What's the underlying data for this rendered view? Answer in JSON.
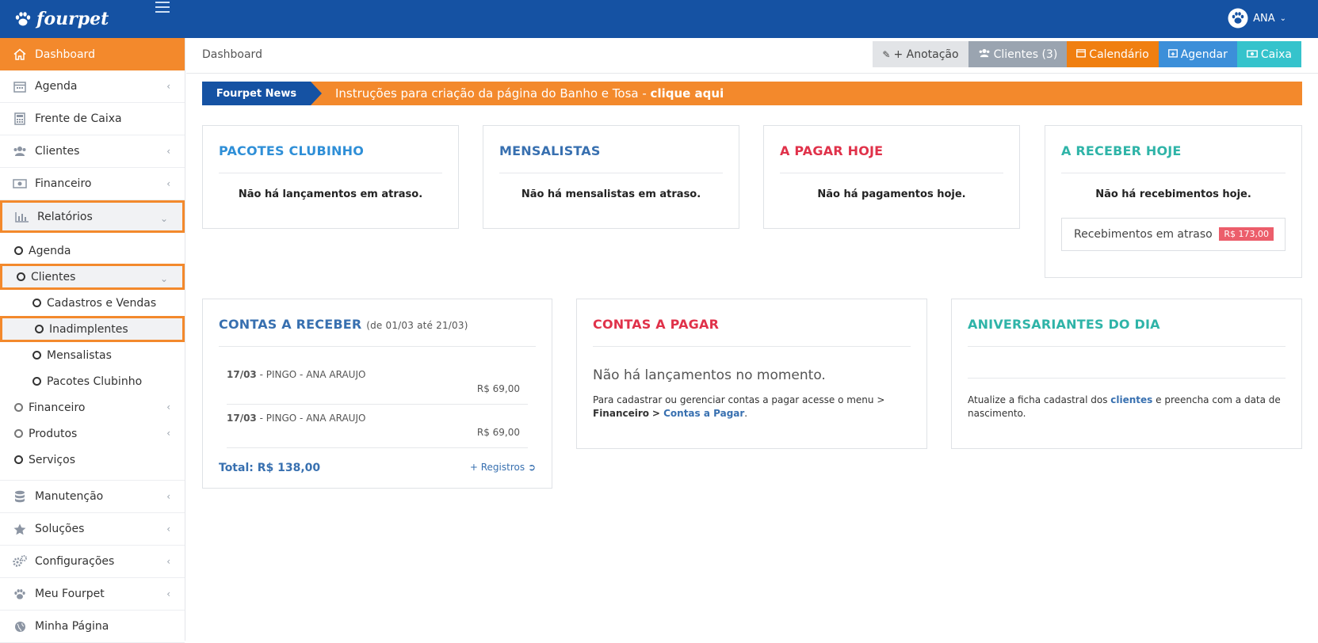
{
  "brand": {
    "name": "fourpet"
  },
  "user": {
    "name": "ANA"
  },
  "sidebar": {
    "dashboard": "Dashboard",
    "agenda": "Agenda",
    "frente_caixa": "Frente de Caixa",
    "clientes": "Clientes",
    "financeiro": "Financeiro",
    "relatorios": "Relatórios",
    "relatorios_sub": {
      "agenda": "Agenda",
      "clientes": "Clientes",
      "cadastros": "Cadastros e Vendas",
      "inadimplentes": "Inadimplentes",
      "mensalistas": "Mensalistas",
      "pacotes": "Pacotes Clubinho",
      "financeiro": "Financeiro",
      "produtos": "Produtos",
      "servicos": "Serviços"
    },
    "manutencao": "Manutenção",
    "solucoes": "Soluções",
    "configuracoes": "Configurações",
    "meu_fourpet": "Meu Fourpet",
    "minha_pagina": "Minha Página"
  },
  "header": {
    "breadcrumb": "Dashboard",
    "buttons": {
      "anotacao": "+ Anotação",
      "clientes": "Clientes (3)",
      "calendario": "Calendário",
      "agendar": "Agendar",
      "caixa": "Caixa"
    }
  },
  "news": {
    "label": "Fourpet News",
    "text": "Instruções para criação da página do Banho e Tosa - ",
    "link": "clique aqui"
  },
  "cards": {
    "pacotes": {
      "title": "PACOTES CLUBINHO",
      "msg": "Não há lançamentos em atraso."
    },
    "mensalistas": {
      "title": "MENSALISTAS",
      "msg": "Não há mensalistas em atraso."
    },
    "pagar_hoje": {
      "title": "A PAGAR HOJE",
      "msg": "Não há pagamentos hoje."
    },
    "receber_hoje": {
      "title": "A RECEBER HOJE",
      "msg": "Não há recebimentos hoje.",
      "overdue_label": "Recebimentos em atraso",
      "overdue_value": "R$ 173,00"
    },
    "contas_receber": {
      "title": "CONTAS A RECEBER",
      "range": "(de 01/03 até 21/03)",
      "rows": [
        {
          "date": "17/03",
          "desc": " - PINGO - ANA ARAUJO",
          "value": "R$ 69,00"
        },
        {
          "date": "17/03",
          "desc": " - PINGO - ANA ARAUJO",
          "value": "R$ 69,00"
        }
      ],
      "total": "Total: R$ 138,00",
      "more": "+ Registros"
    },
    "contas_pagar": {
      "title": "CONTAS A PAGAR",
      "empty": "Não há lançamentos no momento.",
      "help_1": "Para cadastrar ou gerenciar contas a pagar acesse o menu > ",
      "help_link_1": "Financeiro",
      "help_2": "> ",
      "help_link_2": "Contas a Pagar",
      "help_3": "."
    },
    "aniversariantes": {
      "title": "ANIVERSARIANTES DO DIA",
      "help_1": "Atualize a ficha cadastral dos ",
      "help_link": "clientes",
      "help_2": " e preencha com a data de nascimento."
    }
  }
}
